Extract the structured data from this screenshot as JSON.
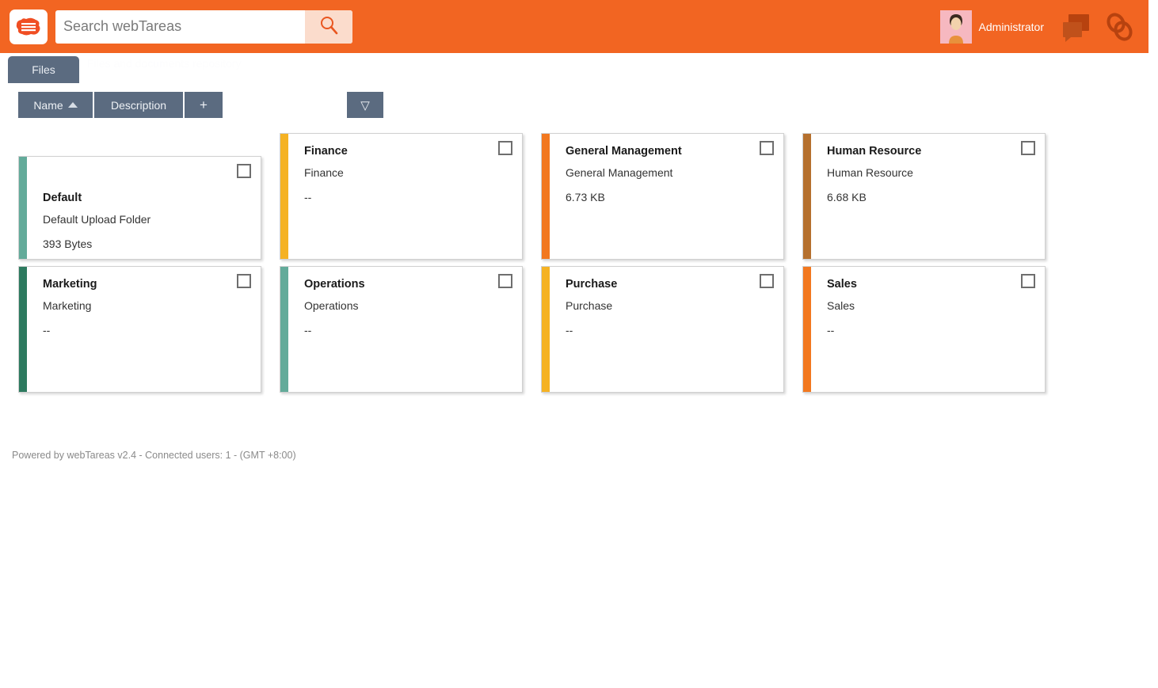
{
  "header": {
    "logo_icon": "webtareas-cloud-logo-icon",
    "search": {
      "placeholder": "Search webTareas",
      "value": "",
      "button_icon": "search-icon"
    },
    "user": {
      "name": "Administrator",
      "avatar_icon": "user-avatar-icon"
    },
    "icons": [
      {
        "name": "chat-bubbles-icon",
        "label": "Messages"
      },
      {
        "name": "chain-link-icon",
        "label": "Links"
      }
    ],
    "accent_color": "#f26522"
  },
  "ghost_text": "Files and documents repository",
  "tabs": [
    {
      "label": "Files",
      "active": true
    }
  ],
  "filterbar": {
    "name_label": "Name",
    "name_sort": "asc",
    "description_label": "Description",
    "add_label": "+",
    "filter_value": "",
    "filter_placeholder": "",
    "funnel_icon": "filter-funnel-icon",
    "funnel_glyph": "▽",
    "bar_color": "#5b6b80"
  },
  "cards": [
    {
      "title": "Default",
      "description": "Default Upload Folder",
      "size": "393 Bytes",
      "accent": "#63ab9a",
      "checked": false,
      "short": true
    },
    {
      "title": "Finance",
      "description": "Finance",
      "size": "--",
      "accent": "#f5b223",
      "checked": false,
      "short": false
    },
    {
      "title": "General Management",
      "description": "General Management",
      "size": "6.73 KB",
      "accent": "#f2781f",
      "checked": false,
      "short": false
    },
    {
      "title": "Human Resource",
      "description": "Human Resource",
      "size": "6.68 KB",
      "accent": "#b5702e",
      "checked": false,
      "short": false
    },
    {
      "title": "Marketing",
      "description": "Marketing",
      "size": "--",
      "accent": "#2d7a5f",
      "checked": false,
      "short": false
    },
    {
      "title": "Operations",
      "description": "Operations",
      "size": "--",
      "accent": "#63ab9a",
      "checked": false,
      "short": false
    },
    {
      "title": "Purchase",
      "description": "Purchase",
      "size": "--",
      "accent": "#f5b223",
      "checked": false,
      "short": false
    },
    {
      "title": "Sales",
      "description": "Sales",
      "size": "--",
      "accent": "#f2781f",
      "checked": false,
      "short": false
    }
  ],
  "footer": {
    "text": "Powered by webTareas v2.4 - Connected users: 1 - (GMT +8:00)"
  }
}
